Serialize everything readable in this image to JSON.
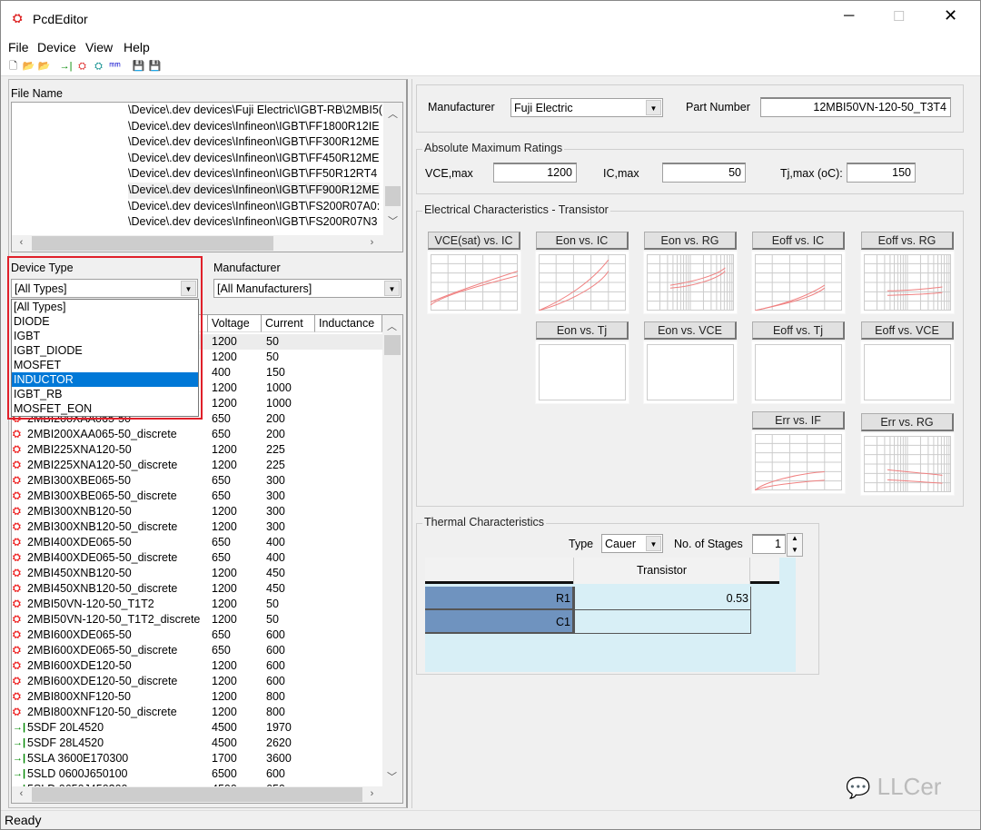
{
  "window": {
    "title": "PcdEditor",
    "controls": [
      "minimize",
      "maximize",
      "close"
    ]
  },
  "menu": [
    "File",
    "Device",
    "View",
    "Help"
  ],
  "toolbar": [
    {
      "icon": "new-file-icon",
      "glyph": "🗋"
    },
    {
      "icon": "open-folder-icon",
      "glyph": "📂"
    },
    {
      "icon": "open-folder-alt-icon",
      "glyph": "📂"
    },
    {
      "icon": "diode-icon",
      "glyph": "→|"
    },
    {
      "icon": "igbt-icon",
      "glyph": "⛭"
    },
    {
      "icon": "igbt-diode-icon",
      "glyph": "⛭"
    },
    {
      "icon": "inductor-icon",
      "glyph": "ᵐᵐ"
    },
    {
      "icon": "save-icon",
      "glyph": "💾"
    },
    {
      "icon": "save-all-icon",
      "glyph": "💾"
    }
  ],
  "left": {
    "file_name_label": "File Name",
    "files": [
      "\\Device\\.dev devices\\Fuji Electric\\IGBT-RB\\2MBI5(",
      "\\Device\\.dev devices\\Infineon\\IGBT\\FF1800R12IE",
      "\\Device\\.dev devices\\Infineon\\IGBT\\FF300R12ME",
      "\\Device\\.dev devices\\Infineon\\IGBT\\FF450R12ME",
      "\\Device\\.dev devices\\Infineon\\IGBT\\FF50R12RT4",
      "\\Device\\.dev devices\\Infineon\\IGBT\\FF900R12ME",
      "\\Device\\.dev devices\\Infineon\\IGBT\\FS200R07A0:",
      "\\Device\\.dev devices\\Infineon\\IGBT\\FS200R07N3"
    ],
    "device_type_label": "Device Type",
    "device_type_value": "[All Types]",
    "device_type_options": [
      "[All Types]",
      "DIODE",
      "IGBT",
      "IGBT_DIODE",
      "MOSFET",
      "INDUCTOR",
      "IGBT_RB",
      "MOSFET_EON"
    ],
    "device_type_highlighted": "INDUCTOR",
    "manufacturer_label": "Manufacturer",
    "manufacturer_value": "[All Manufacturers]",
    "columns": [
      "Voltage",
      "Current",
      "Inductance"
    ],
    "rows": [
      {
        "name": "",
        "v": "1200",
        "i": "50",
        "type": "igbt"
      },
      {
        "name": "",
        "v": "1200",
        "i": "50",
        "type": "igbt"
      },
      {
        "name": "",
        "v": "400",
        "i": "150",
        "type": "igbt"
      },
      {
        "name": "",
        "v": "1200",
        "i": "1000",
        "type": "igbt"
      },
      {
        "name": "",
        "v": "1200",
        "i": "1000",
        "type": "igbt"
      },
      {
        "name": "2MBI200XAA065-50",
        "v": "650",
        "i": "200",
        "type": "igbt"
      },
      {
        "name": "2MBI200XAA065-50_discrete",
        "v": "650",
        "i": "200",
        "type": "igbt"
      },
      {
        "name": "2MBI225XNA120-50",
        "v": "1200",
        "i": "225",
        "type": "igbt"
      },
      {
        "name": "2MBI225XNA120-50_discrete",
        "v": "1200",
        "i": "225",
        "type": "igbt"
      },
      {
        "name": "2MBI300XBE065-50",
        "v": "650",
        "i": "300",
        "type": "igbt"
      },
      {
        "name": "2MBI300XBE065-50_discrete",
        "v": "650",
        "i": "300",
        "type": "igbt"
      },
      {
        "name": "2MBI300XNB120-50",
        "v": "1200",
        "i": "300",
        "type": "igbt"
      },
      {
        "name": "2MBI300XNB120-50_discrete",
        "v": "1200",
        "i": "300",
        "type": "igbt"
      },
      {
        "name": "2MBI400XDE065-50",
        "v": "650",
        "i": "400",
        "type": "igbt"
      },
      {
        "name": "2MBI400XDE065-50_discrete",
        "v": "650",
        "i": "400",
        "type": "igbt"
      },
      {
        "name": "2MBI450XNB120-50",
        "v": "1200",
        "i": "450",
        "type": "igbt"
      },
      {
        "name": "2MBI450XNB120-50_discrete",
        "v": "1200",
        "i": "450",
        "type": "igbt"
      },
      {
        "name": "2MBI50VN-120-50_T1T2",
        "v": "1200",
        "i": "50",
        "type": "igbt"
      },
      {
        "name": "2MBI50VN-120-50_T1T2_discrete",
        "v": "1200",
        "i": "50",
        "type": "igbt"
      },
      {
        "name": "2MBI600XDE065-50",
        "v": "650",
        "i": "600",
        "type": "igbt"
      },
      {
        "name": "2MBI600XDE065-50_discrete",
        "v": "650",
        "i": "600",
        "type": "igbt"
      },
      {
        "name": "2MBI600XDE120-50",
        "v": "1200",
        "i": "600",
        "type": "igbt"
      },
      {
        "name": "2MBI600XDE120-50_discrete",
        "v": "1200",
        "i": "600",
        "type": "igbt"
      },
      {
        "name": "2MBI800XNF120-50",
        "v": "1200",
        "i": "800",
        "type": "igbt"
      },
      {
        "name": "2MBI800XNF120-50_discrete",
        "v": "1200",
        "i": "800",
        "type": "igbt"
      },
      {
        "name": "5SDF 20L4520",
        "v": "4500",
        "i": "1970",
        "type": "diode"
      },
      {
        "name": "5SDF 28L4520",
        "v": "4500",
        "i": "2620",
        "type": "diode"
      },
      {
        "name": "5SLA 3600E170300",
        "v": "1700",
        "i": "3600",
        "type": "diode"
      },
      {
        "name": "5SLD 0600J650100",
        "v": "6500",
        "i": "600",
        "type": "diode"
      },
      {
        "name": "5SLD 0650J450300",
        "v": "4500",
        "i": "650",
        "type": "diode"
      }
    ]
  },
  "right": {
    "manufacturer_label": "Manufacturer",
    "manufacturer_value": "Fuji Electric",
    "part_number_label": "Part Number",
    "part_number_value": "12MBI50VN-120-50_T3T4",
    "amr": {
      "title": "Absolute Maximum Ratings",
      "vce_label": "VCE,max",
      "vce": "1200",
      "ic_label": "IC,max",
      "ic": "50",
      "tj_label": "Tj,max (oC):",
      "tj": "150"
    },
    "elec": {
      "title": "Electrical Characteristics - Transistor",
      "plots": [
        {
          "label": "VCE(sat) vs. IC",
          "scale": "linear",
          "curves": "vce"
        },
        {
          "label": "Eon vs. IC",
          "scale": "linear",
          "curves": "eon"
        },
        {
          "label": "Eon vs. RG",
          "scale": "log",
          "curves": "eonrg"
        },
        {
          "label": "Eoff vs. IC",
          "scale": "linear",
          "curves": "eoff"
        },
        {
          "label": "Eoff vs. RG",
          "scale": "log",
          "curves": "eoffrg"
        },
        {
          "label": "Eon vs. Tj",
          "scale": "none",
          "curves": ""
        },
        {
          "label": "Eon vs. VCE",
          "scale": "none",
          "curves": ""
        },
        {
          "label": "Eoff vs. Tj",
          "scale": "none",
          "curves": ""
        },
        {
          "label": "Eoff vs. VCE",
          "scale": "none",
          "curves": ""
        },
        {
          "label": "Err vs. IF",
          "scale": "linear",
          "curves": "err"
        },
        {
          "label": "Err vs. RG",
          "scale": "log",
          "curves": "errrg"
        }
      ]
    },
    "thermal": {
      "title": "Thermal Characteristics",
      "type_label": "Type",
      "type_value": "Cauer",
      "stages_label": "No. of Stages",
      "stages_value": "1",
      "column": "Transistor",
      "rows": [
        {
          "label": "R1",
          "value": "0.53"
        },
        {
          "label": "C1",
          "value": ""
        }
      ]
    }
  },
  "status": "Ready",
  "watermark": "LLCer",
  "colors": {
    "highlight": "#0078d7",
    "row_header": "#6f93bf",
    "grid_bg": "#d8eff6",
    "curve": "#f08080",
    "callout": "#e0202a"
  }
}
